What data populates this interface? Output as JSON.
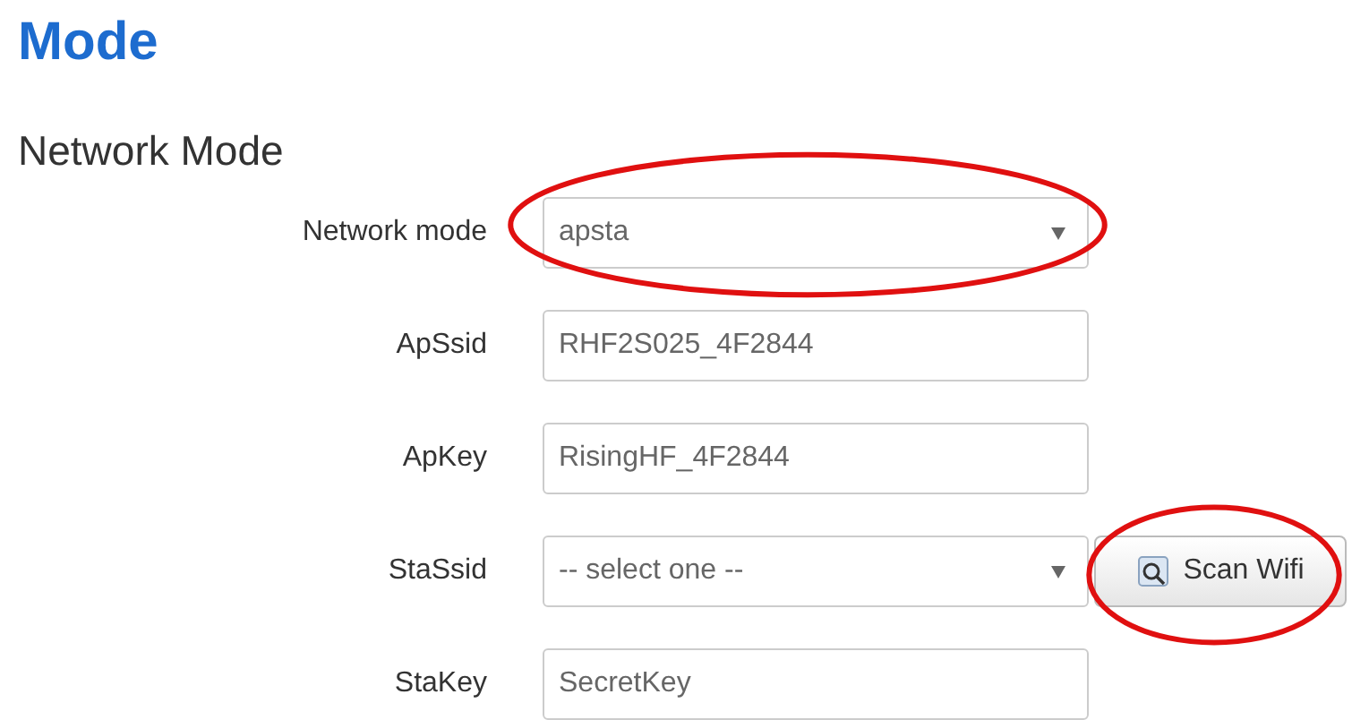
{
  "title": "Mode",
  "section": {
    "title": "Network Mode",
    "fields": [
      {
        "label": "Network mode",
        "kind": "select",
        "value": "apsta",
        "highlighted": true
      },
      {
        "label": "ApSsid",
        "kind": "text",
        "value": "RHF2S025_4F2844",
        "highlighted": false
      },
      {
        "label": "ApKey",
        "kind": "text",
        "value": "RisingHF_4F2844",
        "highlighted": false
      },
      {
        "label": "StaSsid",
        "kind": "select",
        "value": "-- select one --",
        "highlighted": false,
        "button": {
          "label": "Scan Wifi",
          "highlighted": true
        }
      },
      {
        "label": "StaKey",
        "kind": "text",
        "value": "SecretKey",
        "highlighted": false
      }
    ]
  }
}
